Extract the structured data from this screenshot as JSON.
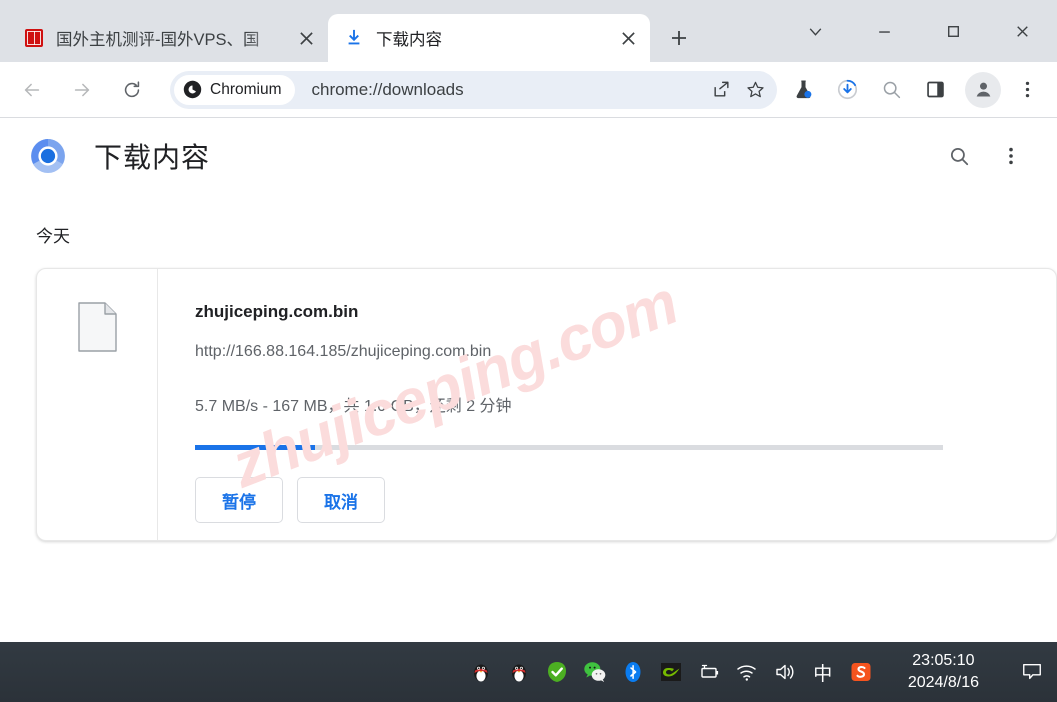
{
  "window": {
    "controls": [
      {
        "name": "tab-search",
        "icon": "chevron-down-icon"
      },
      {
        "name": "minimize",
        "icon": "minimize-icon"
      },
      {
        "name": "maximize",
        "icon": "maximize-icon"
      },
      {
        "name": "close",
        "icon": "close-icon"
      }
    ]
  },
  "tabs": [
    {
      "title": "国外主机测评-国外VPS、国",
      "favicon": "site-favicon-red",
      "active": false
    },
    {
      "title": "下载内容",
      "favicon": "download-icon",
      "active": true
    }
  ],
  "new_tab_label": "+",
  "toolbar": {
    "back_label": "后退",
    "forward_label": "前进",
    "reload_label": "重新加载",
    "chip_label": "Chromium",
    "url": "chrome://downloads",
    "share_label": "分享",
    "bookmark_label": "将此标签页加入书签",
    "icons": [
      "share-icon",
      "bookmark-star-icon",
      "experiments-flask-icon",
      "downloads-progress-icon",
      "search-icon",
      "side-panel-icon",
      "profile-avatar-icon",
      "three-dot-menu-icon"
    ]
  },
  "page": {
    "title": "下载内容",
    "logo": "chromium-logo",
    "search_label": "搜索下载内容",
    "menu_label": "更多选项",
    "section_label": "今天",
    "download": {
      "filename": "zhujiceping.com.bin",
      "url": "http://166.88.164.185/zhujiceping.com.bin",
      "status": "5.7 MB/s - 167 MB，共 1.0 GB，还剩 2 分钟",
      "progress_percent": 16,
      "file_icon": "generic-file-icon",
      "buttons": [
        {
          "label": "暂停",
          "name": "pause-button"
        },
        {
          "label": "取消",
          "name": "cancel-button"
        }
      ]
    }
  },
  "watermark": "zhujiceping.com",
  "taskbar": {
    "tray_icons": [
      "qq-penguin-icon",
      "qq-penguin-icon",
      "security-check-icon",
      "wechat-icon",
      "bluetooth-icon",
      "nvidia-icon",
      "battery-icon",
      "wifi-icon",
      "volume-icon"
    ],
    "ime_label": "中",
    "sogou_label": "S",
    "time": "23:05:10",
    "date": "2024/8/16",
    "notification_label": "通知"
  },
  "colors": {
    "accent_blue": "#1a73e8",
    "tabstrip_bg": "#dee1e6",
    "omnibox_bg": "#e9eef6",
    "watermark_pink": "#fbdcdc",
    "taskbar_bg": "#2d343c"
  }
}
